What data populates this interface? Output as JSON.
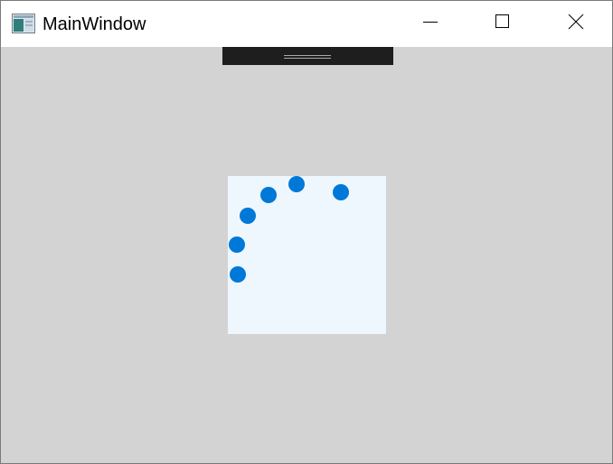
{
  "window": {
    "title": "MainWindow",
    "icons": {
      "app": "app-window-icon",
      "minimize": "minimize-icon",
      "maximize": "maximize-icon",
      "close": "close-icon"
    }
  },
  "colors": {
    "client_background": "#d3d3d3",
    "canvas_background": "#eef7fe",
    "dot": "#0078d7",
    "debug_bar": "#1e1e1e"
  },
  "canvas": {
    "dot_count": 6
  }
}
